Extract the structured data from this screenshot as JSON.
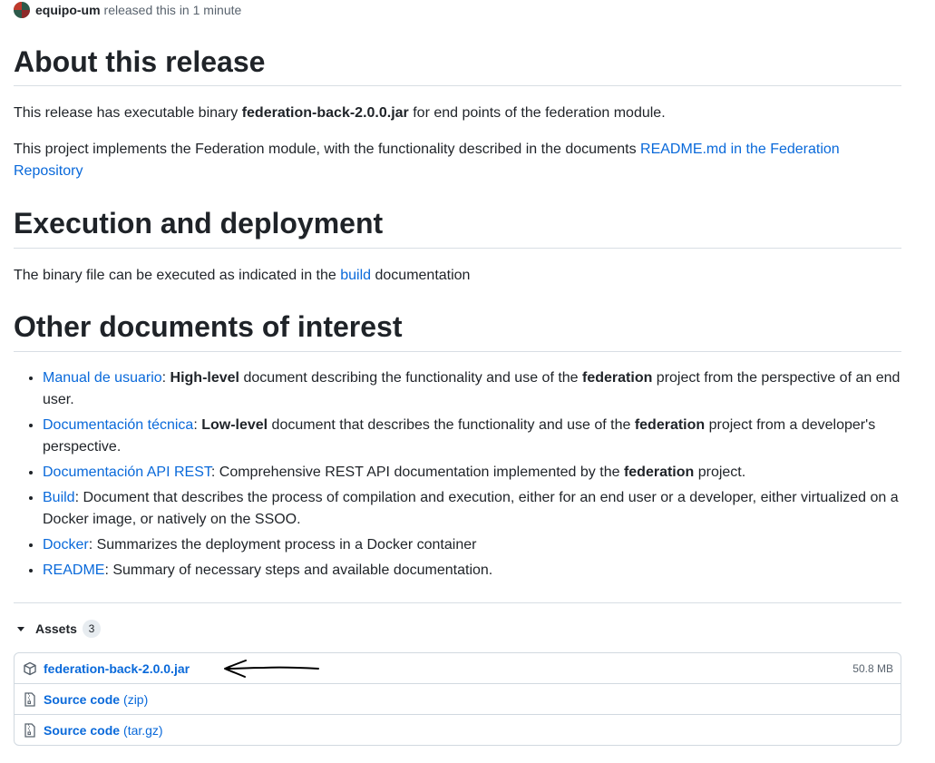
{
  "header": {
    "author": "equipo-um",
    "released_text": "released this in 1 minute",
    "avatar_icon": "org-avatar-icon"
  },
  "sections": {
    "about": {
      "title": "About this release",
      "p1_prefix": "This release has executable binary ",
      "p1_bold": "federation-back-2.0.0.jar",
      "p1_suffix": " for end points of the federation module.",
      "p2_prefix": "This project implements the Federation module, with the functionality described in the documents ",
      "p2_link": "README.md in the Federation Repository"
    },
    "execution": {
      "title": "Execution and deployment",
      "p_prefix": "The binary file can be executed as indicated in the ",
      "p_link": "build",
      "p_suffix": " documentation"
    },
    "other": {
      "title": "Other documents of interest",
      "items": [
        {
          "link": "Manual de usuario",
          "sep": ": ",
          "bold1": "High-level",
          "mid": " document describing the functionality and use of the ",
          "bold2": "federation",
          "end": " project from the perspective of an end user."
        },
        {
          "link": "Documentación técnica",
          "sep": ": ",
          "bold1": "Low-level",
          "mid": " document that describes the functionality and use of the ",
          "bold2": "federation",
          "end": " project from a developer's perspective."
        },
        {
          "link": "Documentación API REST",
          "sep": ": ",
          "bold1": "",
          "mid": "Comprehensive REST API documentation implemented by the ",
          "bold2": "federation",
          "end": " project."
        },
        {
          "link": "Build",
          "sep": ": ",
          "bold1": "",
          "mid": "Document that describes the process of compilation and execution, either for an end user or a developer, either virtualized on a Docker image, or natively on the SSOO.",
          "bold2": "",
          "end": ""
        },
        {
          "link": "Docker",
          "sep": ": ",
          "bold1": "",
          "mid": "Summarizes the deployment process in a Docker container",
          "bold2": "",
          "end": ""
        },
        {
          "link": "README",
          "sep": ": ",
          "bold1": "",
          "mid": "Summary of necessary steps and available documentation.",
          "bold2": "",
          "end": ""
        }
      ]
    }
  },
  "assets": {
    "label": "Assets",
    "count": "3",
    "items": [
      {
        "name": "federation-back-2.0.0.jar",
        "suffix": "",
        "size": "50.8 MB",
        "icon": "package-icon"
      },
      {
        "name": "Source code",
        "suffix": "(zip)",
        "size": "",
        "icon": "file-zip-icon"
      },
      {
        "name": "Source code",
        "suffix": "(tar.gz)",
        "size": "",
        "icon": "file-zip-icon"
      }
    ]
  },
  "annotation": {
    "icon": "hand-drawn-arrow-icon"
  },
  "colors": {
    "link": "#0969da",
    "text": "#1f2328",
    "muted": "#59636e",
    "border": "#d1d9e0"
  }
}
